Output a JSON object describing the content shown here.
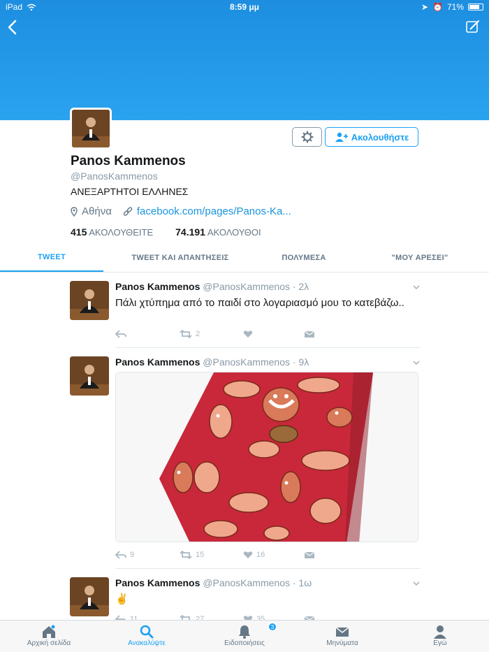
{
  "status_bar": {
    "device": "iPad",
    "time": "8:59 μμ",
    "battery": "71%"
  },
  "profile": {
    "name": "Panos Kammenos",
    "handle": "@PanosKammenos",
    "bio": "ΑΝΕΞΑΡΤΗΤΟΙ ΕΛΛΗΝΕΣ",
    "location": "Αθήνα",
    "link": "facebook.com/pages/Panos-Ka...",
    "follow_label": "Ακολουθήστε",
    "following_count": "415",
    "following_label": "ΑΚΟΛΟΥΘΕΙΤΕ",
    "followers_count": "74.191",
    "followers_label": "ΑΚΟΛΟΥΘΟΙ"
  },
  "tabs": [
    {
      "label": "TWEET"
    },
    {
      "label": "TWEET ΚΑΙ ΑΠΑΝΤΗΣΕΙΣ"
    },
    {
      "label": "ΠΟΛΥΜΕΣΑ"
    },
    {
      "label": "\"ΜΟΥ ΑΡΕΣΕΙ\""
    }
  ],
  "tweets": [
    {
      "name": "Panos Kammenos",
      "handle": "@PanosKammenos",
      "time": "· 2λ",
      "text": "Πάλι χτύπημα από το παιδί στο λογαριασμό μου το κατεβάζω..",
      "reply_count": "",
      "retweet_count": "2",
      "like_count": ""
    },
    {
      "name": "Panos Kammenos",
      "handle": "@PanosKammenos",
      "time": "· 9λ",
      "text": "",
      "reply_count": "9",
      "retweet_count": "15",
      "like_count": "16"
    },
    {
      "name": "Panos Kammenos",
      "handle": "@PanosKammenos",
      "time": "· 1ω",
      "text": "✌️",
      "reply_count": "11",
      "retweet_count": "27",
      "like_count": "35"
    }
  ],
  "tabbar": [
    {
      "label": "Αρχική σελίδα",
      "icon": "home-icon"
    },
    {
      "label": "Ανακαλύψτε",
      "icon": "search-icon"
    },
    {
      "label": "Ειδοποιήσεις",
      "icon": "bell-icon",
      "badge": "3"
    },
    {
      "label": "Μηνύματα",
      "icon": "mail-icon"
    },
    {
      "label": "Εγώ",
      "icon": "person-icon"
    }
  ],
  "colors": {
    "accent": "#1da1f2",
    "header": "#2aa3ef",
    "muted": "#8899a6"
  }
}
